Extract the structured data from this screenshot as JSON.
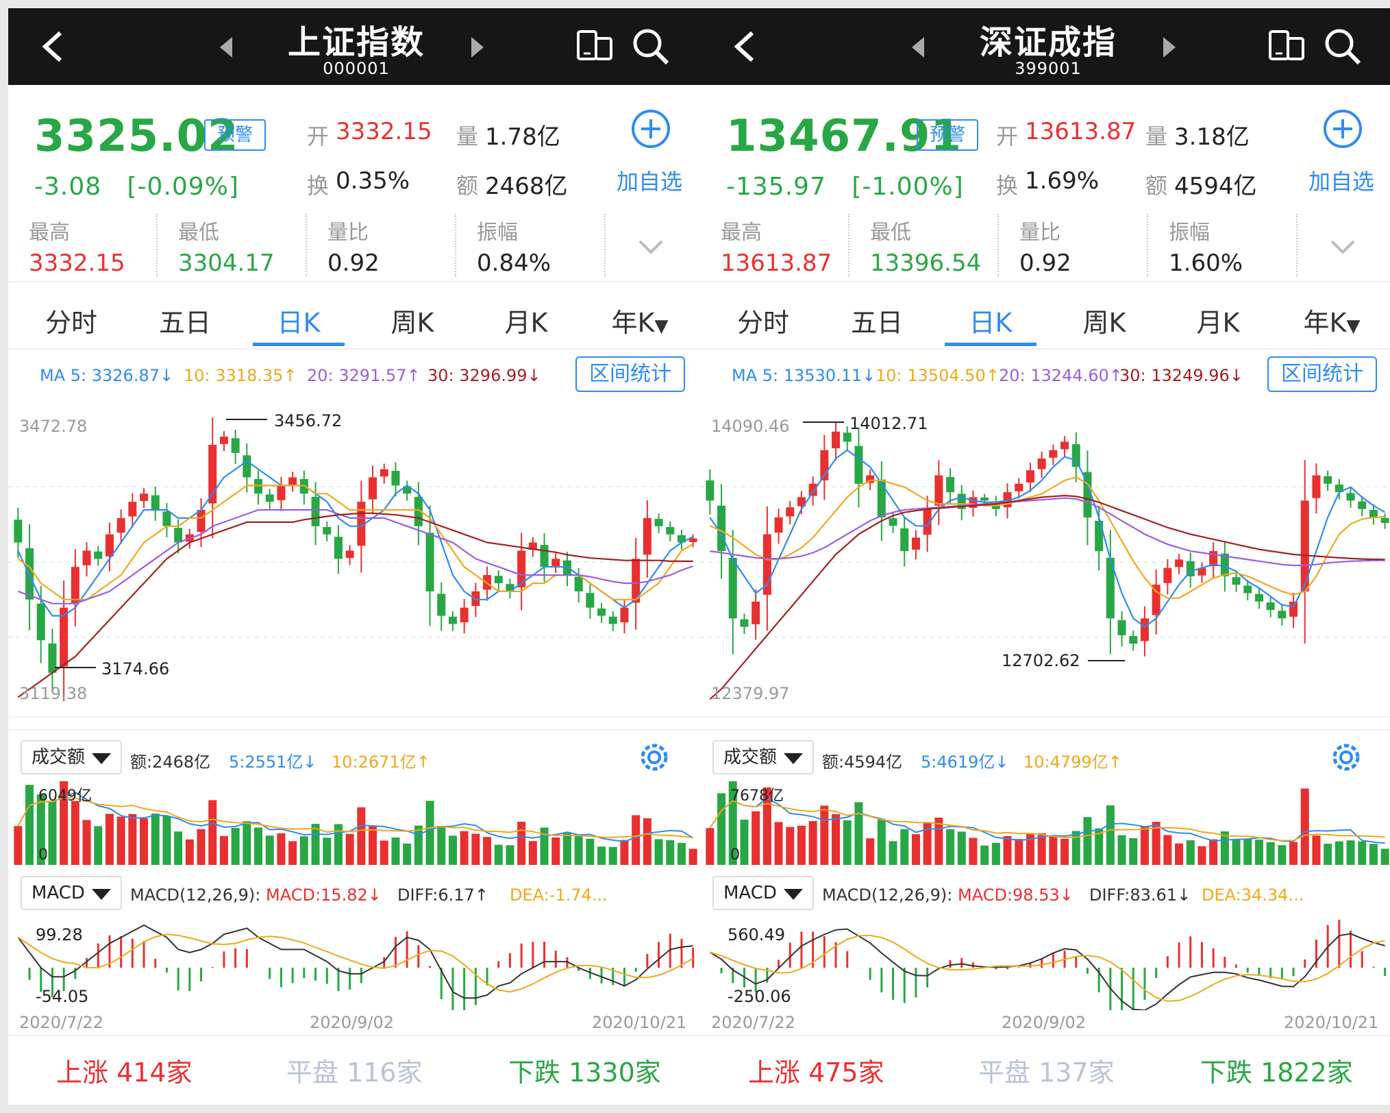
{
  "panels": [
    {
      "title": "上证指数",
      "code": "000001",
      "price": "3325.02",
      "alert_label": "预警",
      "change": "-3.08",
      "change_pct": "[-0.09%]",
      "quote": {
        "open_label": "开",
        "open": "3332.15",
        "volume_label": "量",
        "volume": "1.78亿",
        "turnover_label": "换",
        "turnover": "0.35%",
        "amount_label": "额",
        "amount": "2468亿"
      },
      "add_watch": "加自选",
      "stats": [
        {
          "label": "最高",
          "value": "3332.15",
          "color": "red"
        },
        {
          "label": "最低",
          "value": "3304.17",
          "color": "grn"
        },
        {
          "label": "量比",
          "value": "0.92",
          "color": "blk"
        },
        {
          "label": "振幅",
          "value": "0.84%",
          "color": "blk"
        }
      ],
      "tabs": [
        "分时",
        "五日",
        "日K",
        "周K",
        "月K",
        "年K"
      ],
      "active_tab": "日K",
      "ma": {
        "ma5": "MA 5: 3326.87↓",
        "ma10": "10: 3318.35↑",
        "ma20": "20: 3291.57↑",
        "ma30": "30: 3296.99↓"
      },
      "range_stats": "区间统计",
      "chart_labels": {
        "top": "3472.78",
        "bottom": "3119.38",
        "high_mark": "3456.72",
        "low_mark": "3174.66"
      },
      "volume_bar": {
        "selector": "成交额",
        "amount": "额:2468亿",
        "ma5": "5:2551亿↓",
        "ma10": "10:2671亿↑",
        "max": "6049亿",
        "min": "0"
      },
      "macd_bar": {
        "selector": "MACD",
        "params": "MACD(12,26,9):",
        "macd": "MACD:15.82↓",
        "diff": "DIFF:6.17↑",
        "dea": "DEA:-1.74...",
        "max": "99.28",
        "min": "-54.05"
      },
      "dates": [
        "2020/7/22",
        "2020/9/02",
        "2020/10/21"
      ],
      "breadth": {
        "up": "上涨 414家",
        "flat": "平盘 116家",
        "down": "下跌 1330家"
      }
    },
    {
      "title": "深证成指",
      "code": "399001",
      "price": "13467.91",
      "alert_label": "预警",
      "change": "-135.97",
      "change_pct": "[-1.00%]",
      "quote": {
        "open_label": "开",
        "open": "13613.87",
        "volume_label": "量",
        "volume": "3.18亿",
        "turnover_label": "换",
        "turnover": "1.69%",
        "amount_label": "额",
        "amount": "4594亿"
      },
      "add_watch": "加自选",
      "stats": [
        {
          "label": "最高",
          "value": "13613.87",
          "color": "red"
        },
        {
          "label": "最低",
          "value": "13396.54",
          "color": "grn"
        },
        {
          "label": "量比",
          "value": "0.92",
          "color": "blk"
        },
        {
          "label": "振幅",
          "value": "1.60%",
          "color": "blk"
        }
      ],
      "tabs": [
        "分时",
        "五日",
        "日K",
        "周K",
        "月K",
        "年K"
      ],
      "active_tab": "日K",
      "ma": {
        "ma5": "MA 5: 13530.11↓",
        "ma10": "10: 13504.50↑",
        "ma20": "20: 13244.60↑",
        "ma30": "30: 13249.96↓"
      },
      "range_stats": "区间统计",
      "chart_labels": {
        "top": "14090.46",
        "bottom": "12379.97",
        "high_mark": "14012.71",
        "low_mark": "12702.62"
      },
      "volume_bar": {
        "selector": "成交额",
        "amount": "额:4594亿",
        "ma5": "5:4619亿↓",
        "ma10": "10:4799亿↑",
        "max": "7678亿",
        "min": "0"
      },
      "macd_bar": {
        "selector": "MACD",
        "params": "MACD(12,26,9):",
        "macd": "MACD:98.53↓",
        "diff": "DIFF:83.61↓",
        "dea": "DEA:34.34...",
        "max": "560.49",
        "min": "-250.06"
      },
      "dates": [
        "2020/7/22",
        "2020/9/02",
        "2020/10/21"
      ],
      "breadth": {
        "up": "上涨 475家",
        "flat": "平盘 137家",
        "down": "下跌 1822家"
      }
    }
  ],
  "colors": {
    "up": "#e93030",
    "down": "#28a745",
    "accent": "#2d8cf0",
    "ma5": "#2d8cf0",
    "ma10": "#f0a81c",
    "ma20": "#9a5ee0",
    "ma30": "#a32020"
  },
  "chart_data": [
    {
      "type": "candlestick",
      "title": "上证指数",
      "x_range": [
        "2020/7/22",
        "2020/10/21"
      ],
      "ylim": [
        3119.38,
        3472.78
      ],
      "series": [
        {
          "name": "K",
          "close": [
            3320,
            3250,
            3200,
            3160,
            3240,
            3290,
            3310,
            3300,
            3330,
            3350,
            3370,
            3380,
            3360,
            3340,
            3320,
            3330,
            3360,
            3440,
            3450,
            3430,
            3400,
            3380,
            3370,
            3390,
            3400,
            3380,
            3340,
            3330,
            3300,
            3310,
            3370,
            3400,
            3410,
            3390,
            3380,
            3340,
            3260,
            3230,
            3220,
            3240,
            3260,
            3280,
            3270,
            3260,
            3310,
            3320,
            3290,
            3300,
            3280,
            3260,
            3240,
            3230,
            3220,
            3240,
            3300,
            3350,
            3340,
            3330,
            3320,
            3325
          ]
        },
        {
          "name": "MA 5",
          "values": [
            3310,
            3280,
            3250,
            3230,
            3230,
            3240,
            3260,
            3280,
            3300,
            3320,
            3340,
            3360,
            3360,
            3360,
            3350,
            3350,
            3360,
            3380,
            3400,
            3410,
            3420,
            3410,
            3400,
            3390,
            3390,
            3390,
            3380,
            3370,
            3350,
            3340,
            3340,
            3350,
            3360,
            3380,
            3390,
            3380,
            3360,
            3320,
            3280,
            3260,
            3250,
            3250,
            3260,
            3260,
            3270,
            3280,
            3290,
            3290,
            3290,
            3280,
            3270,
            3260,
            3250,
            3240,
            3250,
            3270,
            3290,
            3310,
            3320,
            3327
          ]
        },
        {
          "name": "10",
          "values": [
            3300,
            3290,
            3270,
            3260,
            3250,
            3250,
            3250,
            3260,
            3270,
            3280,
            3300,
            3320,
            3330,
            3340,
            3340,
            3350,
            3350,
            3360,
            3370,
            3380,
            3390,
            3390,
            3390,
            3390,
            3390,
            3390,
            3380,
            3380,
            3370,
            3360,
            3360,
            3360,
            3360,
            3360,
            3360,
            3360,
            3350,
            3330,
            3310,
            3290,
            3280,
            3270,
            3260,
            3260,
            3260,
            3270,
            3270,
            3280,
            3280,
            3280,
            3270,
            3260,
            3250,
            3250,
            3250,
            3260,
            3270,
            3290,
            3310,
            3318
          ]
        },
        {
          "name": "20",
          "values": [
            3260,
            3255,
            3250,
            3245,
            3245,
            3245,
            3250,
            3255,
            3260,
            3270,
            3280,
            3290,
            3300,
            3310,
            3320,
            3325,
            3330,
            3340,
            3345,
            3350,
            3355,
            3360,
            3360,
            3360,
            3360,
            3360,
            3360,
            3360,
            3355,
            3350,
            3350,
            3350,
            3350,
            3345,
            3340,
            3335,
            3330,
            3325,
            3320,
            3310,
            3300,
            3295,
            3290,
            3285,
            3280,
            3280,
            3280,
            3280,
            3280,
            3280,
            3278,
            3275,
            3272,
            3270,
            3270,
            3272,
            3276,
            3280,
            3286,
            3291
          ]
        },
        {
          "name": "30",
          "values": [
            3130,
            3140,
            3150,
            3160,
            3170,
            3180,
            3195,
            3210,
            3225,
            3240,
            3255,
            3270,
            3285,
            3300,
            3310,
            3320,
            3325,
            3330,
            3335,
            3340,
            3345,
            3345,
            3345,
            3345,
            3345,
            3348,
            3350,
            3352,
            3354,
            3355,
            3356,
            3356,
            3355,
            3354,
            3352,
            3350,
            3345,
            3340,
            3335,
            3330,
            3325,
            3320,
            3318,
            3316,
            3314,
            3312,
            3310,
            3308,
            3305,
            3303,
            3301,
            3300,
            3299,
            3298,
            3298,
            3298,
            3298,
            3297,
            3297,
            3297
          ]
        }
      ]
    },
    {
      "type": "candlestick",
      "title": "深证成指",
      "x_range": [
        "2020/7/22",
        "2020/10/21"
      ],
      "ylim": [
        12379.97,
        14090.46
      ],
      "series": [
        {
          "name": "K",
          "close": [
            13600,
            13300,
            12900,
            12850,
            13000,
            13400,
            13500,
            13560,
            13620,
            13700,
            13900,
            14010,
            13950,
            13700,
            13750,
            13500,
            13450,
            13300,
            13380,
            13550,
            13750,
            13650,
            13550,
            13620,
            13600,
            13550,
            13650,
            13700,
            13780,
            13850,
            13900,
            13950,
            13800,
            13500,
            13300,
            12900,
            12800,
            12750,
            12900,
            13100,
            13200,
            13250,
            13150,
            13200,
            13300,
            13150,
            13100,
            13050,
            13000,
            12950,
            12900,
            13000,
            13600,
            13750,
            13700,
            13650,
            13600,
            13550,
            13500,
            13467
          ]
        },
        {
          "name": "MA 5",
          "values": [
            13500,
            13400,
            13250,
            13150,
            13050,
            13100,
            13250,
            13400,
            13550,
            13650,
            13750,
            13850,
            13900,
            13850,
            13800,
            13700,
            13600,
            13500,
            13450,
            13450,
            13550,
            13600,
            13620,
            13600,
            13590,
            13590,
            13600,
            13620,
            13660,
            13720,
            13800,
            13860,
            13840,
            13700,
            13500,
            13250,
            13050,
            12900,
            12850,
            12900,
            13000,
            13100,
            13180,
            13200,
            13220,
            13210,
            13180,
            13120,
            13080,
            13030,
            12980,
            12970,
            13100,
            13300,
            13500,
            13650,
            13680,
            13620,
            13570,
            13530
          ]
        },
        {
          "name": "10",
          "values": [
            13450,
            13420,
            13380,
            13330,
            13280,
            13250,
            13250,
            13280,
            13320,
            13380,
            13460,
            13540,
            13620,
            13680,
            13720,
            13720,
            13700,
            13680,
            13640,
            13600,
            13580,
            13580,
            13580,
            13580,
            13570,
            13570,
            13580,
            13600,
            13620,
            13640,
            13680,
            13720,
            13740,
            13700,
            13600,
            13480,
            13360,
            13240,
            13140,
            13060,
            13020,
            13020,
            13060,
            13100,
            13140,
            13160,
            13170,
            13150,
            13120,
            13090,
            13060,
            13040,
            13060,
            13150,
            13280,
            13400,
            13460,
            13490,
            13500,
            13504
          ]
        },
        {
          "name": "20",
          "values": [
            13300,
            13290,
            13280,
            13270,
            13260,
            13255,
            13255,
            13260,
            13270,
            13290,
            13320,
            13360,
            13400,
            13440,
            13480,
            13510,
            13530,
            13545,
            13550,
            13555,
            13560,
            13565,
            13570,
            13575,
            13580,
            13585,
            13590,
            13595,
            13600,
            13605,
            13610,
            13615,
            13610,
            13590,
            13560,
            13520,
            13480,
            13440,
            13400,
            13370,
            13340,
            13320,
            13300,
            13290,
            13280,
            13270,
            13260,
            13250,
            13240,
            13230,
            13220,
            13215,
            13215,
            13220,
            13230,
            13235,
            13240,
            13242,
            13244,
            13245
          ]
        },
        {
          "name": "30",
          "values": [
            12420,
            12480,
            12560,
            12640,
            12720,
            12800,
            12880,
            12960,
            13040,
            13120,
            13200,
            13280,
            13340,
            13400,
            13440,
            13480,
            13510,
            13530,
            13540,
            13550,
            13555,
            13560,
            13565,
            13570,
            13575,
            13580,
            13590,
            13600,
            13610,
            13620,
            13625,
            13630,
            13625,
            13610,
            13590,
            13565,
            13540,
            13515,
            13490,
            13465,
            13440,
            13420,
            13400,
            13385,
            13370,
            13355,
            13340,
            13325,
            13310,
            13300,
            13290,
            13280,
            13275,
            13270,
            13265,
            13260,
            13256,
            13253,
            13251,
            13250
          ]
        }
      ]
    }
  ]
}
